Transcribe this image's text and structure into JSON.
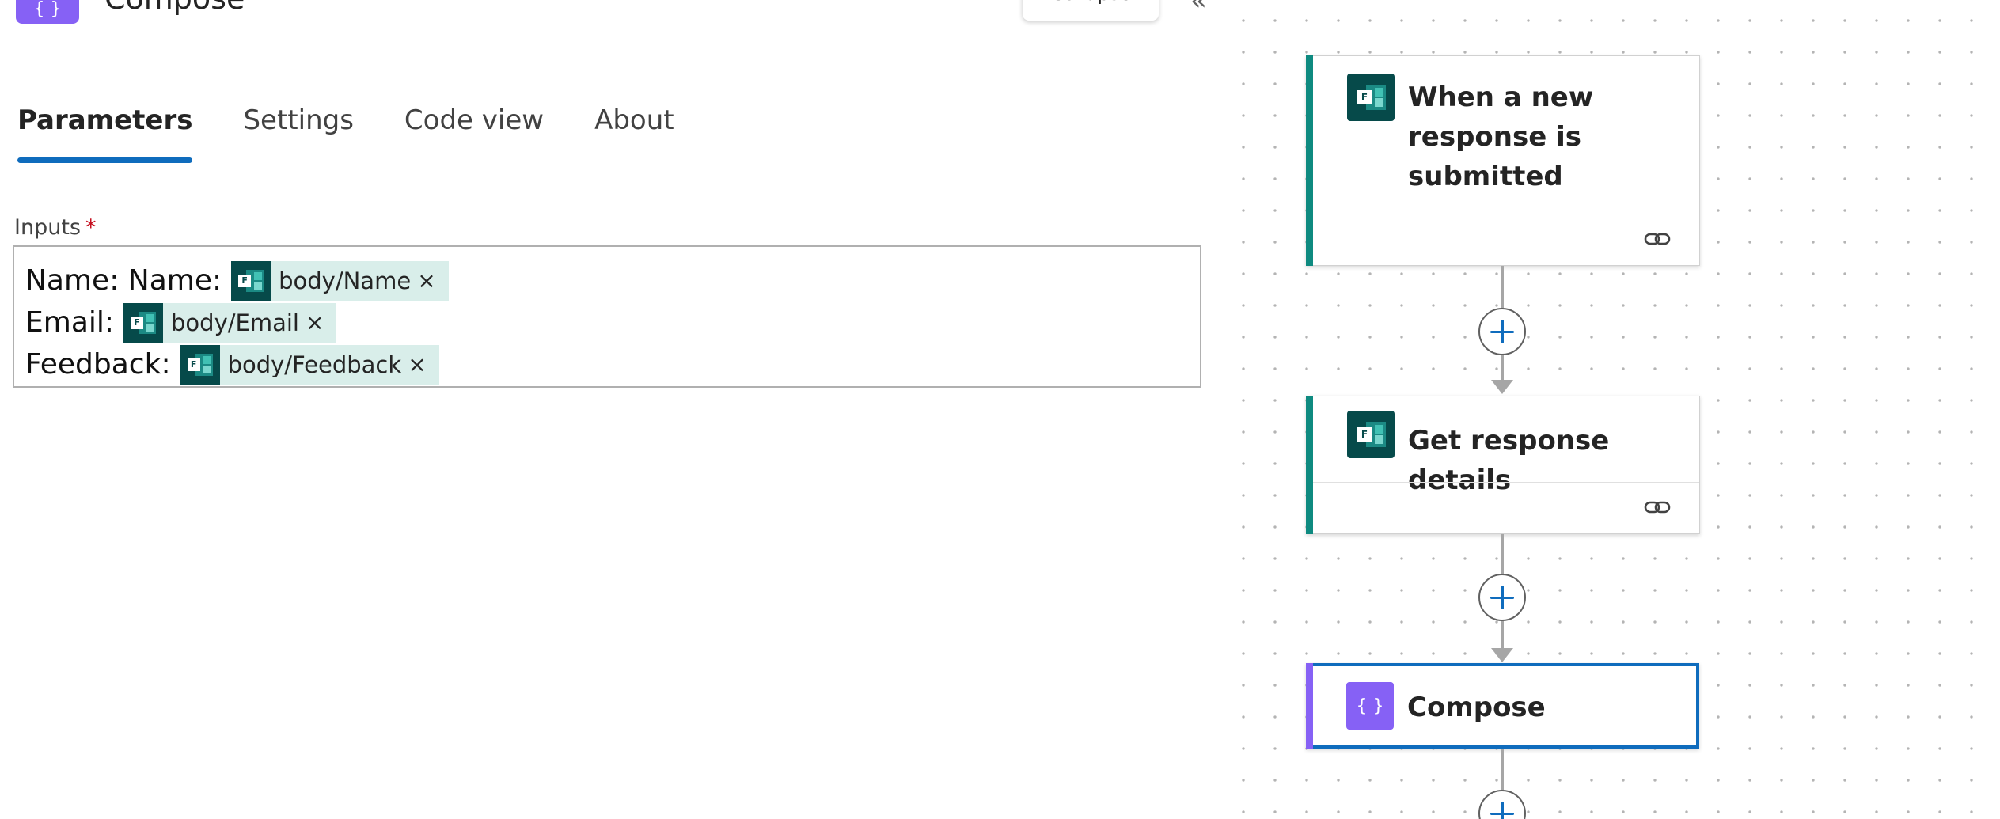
{
  "header": {
    "title": "Compose",
    "icon": "compose-braces-icon",
    "collapse_label": "Collapse"
  },
  "tabs": [
    {
      "label": "Parameters",
      "active": true
    },
    {
      "label": "Settings",
      "active": false
    },
    {
      "label": "Code view",
      "active": false
    },
    {
      "label": "About",
      "active": false
    }
  ],
  "inputs": {
    "label": "Inputs",
    "required_mark": "*",
    "lines": [
      {
        "prefix": "Name: Name:",
        "token": "body/Name",
        "token_close": "×"
      },
      {
        "prefix": "Email:",
        "token": "body/Email",
        "token_close": "×"
      },
      {
        "prefix": "Feedback:",
        "token": "body/Feedback",
        "token_close": "×"
      }
    ]
  },
  "flow": {
    "nodes": [
      {
        "title_lines": [
          "When a new",
          "response is",
          "submitted"
        ],
        "icon": "microsoft-forms-icon",
        "accent": "#0e8a80",
        "footer_icon": "link-icon"
      },
      {
        "title_lines": [
          "Get response details"
        ],
        "icon": "microsoft-forms-icon",
        "accent": "#0e8a80",
        "footer_icon": "link-icon"
      },
      {
        "title_lines": [
          "Compose"
        ],
        "icon": "compose-braces-icon",
        "accent": "#8661f5",
        "selected": true
      }
    ],
    "add_step_icon": "plus-icon"
  },
  "colors": {
    "brand_blue": "#0f6cbd",
    "forms_teal": "#064a4a",
    "token_bg": "#d9eeea",
    "compose_purple": "#8661f5",
    "required_red": "#c50f1f"
  }
}
